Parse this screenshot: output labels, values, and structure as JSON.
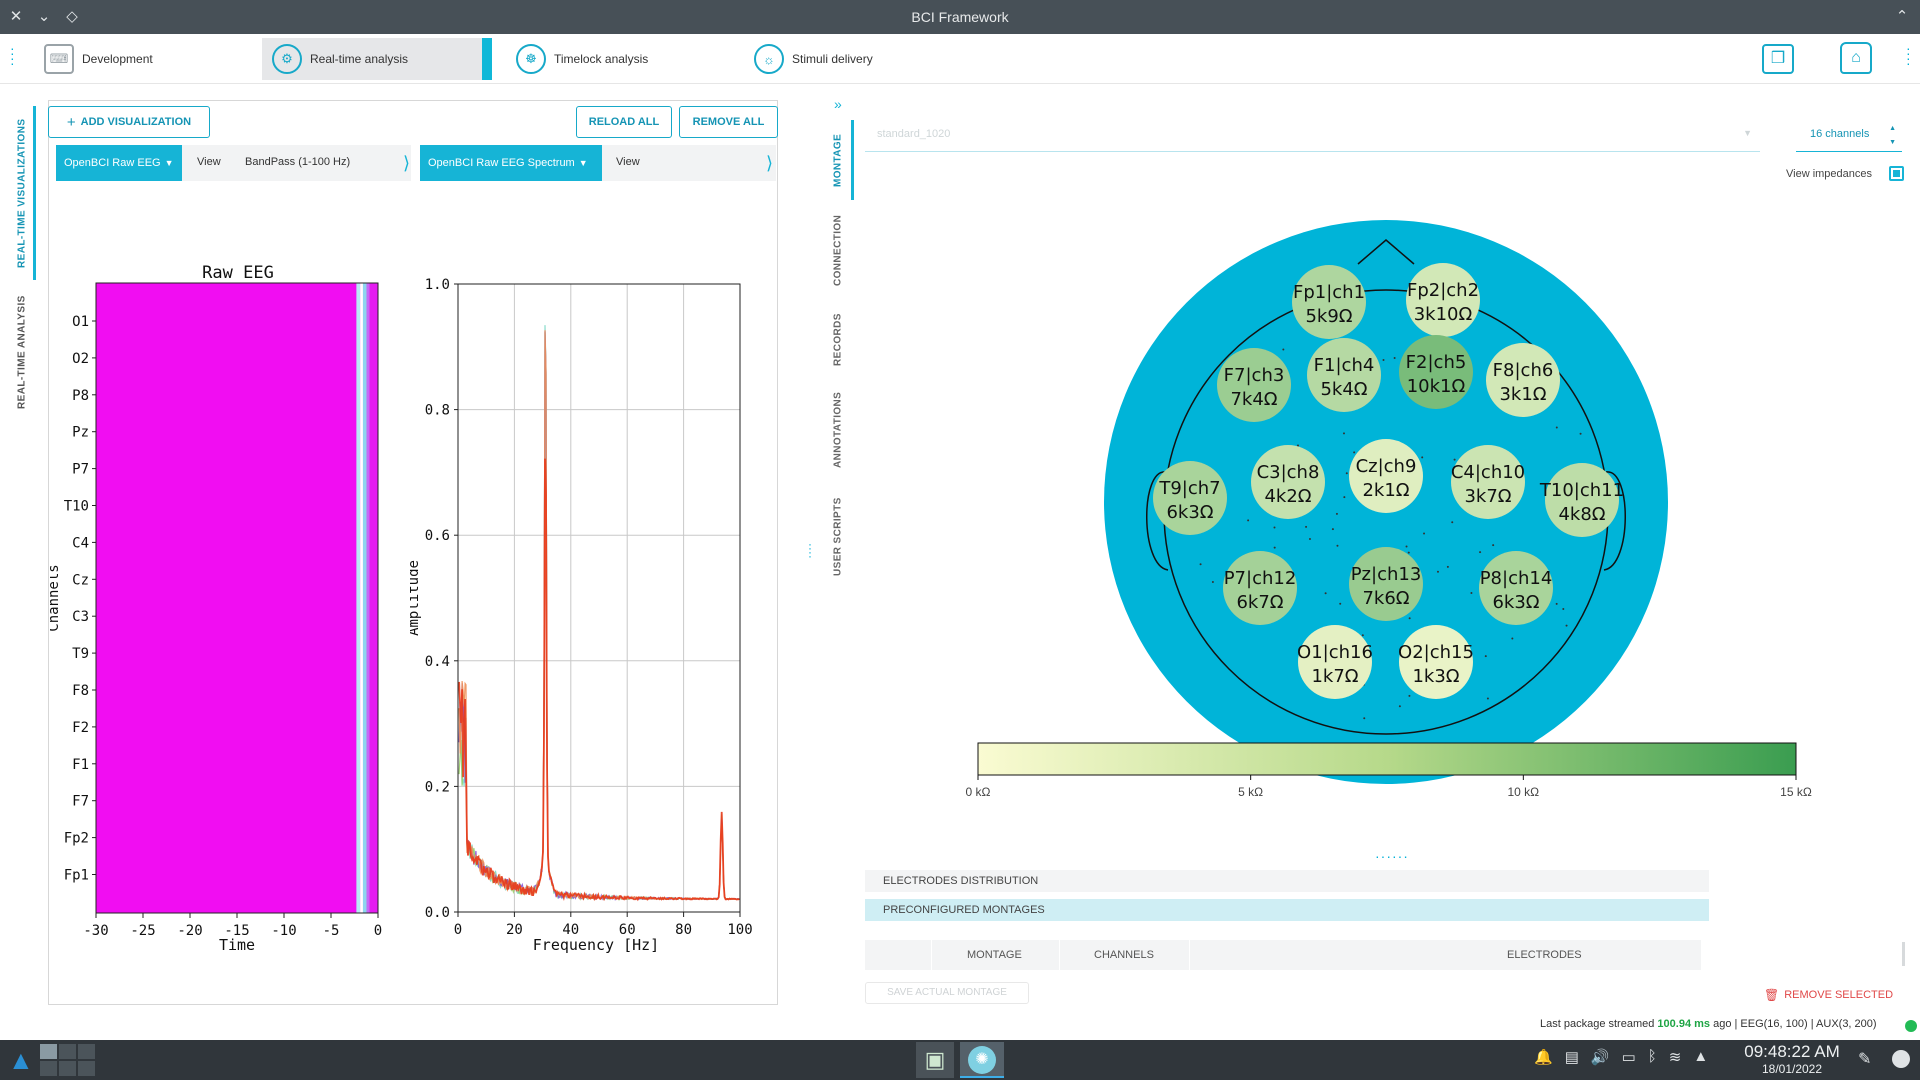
{
  "window": {
    "title": "BCI Framework"
  },
  "main_tabs": [
    {
      "label": "Development",
      "active": false
    },
    {
      "label": "Real-time analysis",
      "active": true
    },
    {
      "label": "Timelock analysis",
      "active": false
    },
    {
      "label": "Stimuli delivery",
      "active": false
    }
  ],
  "left_vertical_tabs": [
    {
      "label": "REAL-TIME VISUALIZATIONS",
      "active": true
    },
    {
      "label": "REAL-TIME ANALYSIS",
      "active": false
    }
  ],
  "toolbar": {
    "add_visualization": "ADD VISUALIZATION",
    "reload_all": "RELOAD ALL",
    "remove_all": "REMOVE ALL"
  },
  "visualizations": [
    {
      "name": "OpenBCI Raw EEG",
      "view_label": "View",
      "filter": "BandPass (1-100 Hz)"
    },
    {
      "name": "OpenBCI Raw EEG Spectrum",
      "view_label": "View"
    }
  ],
  "colors": {
    "accent": "#16b4d6",
    "head": "#00b4d8",
    "electrode_low": "#fafbd2",
    "electrode_high": "#3a9d50",
    "eeg_fill": "#f10df2",
    "status_ok": "#22bb55"
  },
  "chart_data": [
    {
      "type": "heatmap",
      "title": "Raw EEG",
      "xlabel": "Time",
      "ylabel": "Channels",
      "x_ticks": [
        -30,
        -25,
        -20,
        -15,
        -10,
        -5,
        0
      ],
      "xlim": [
        -30,
        0
      ],
      "channels": [
        "O1",
        "O2",
        "P8",
        "Pz",
        "P7",
        "T10",
        "C4",
        "Cz",
        "C3",
        "T9",
        "F8",
        "F2",
        "F1",
        "F7",
        "Fp2",
        "Fp1"
      ]
    },
    {
      "type": "line",
      "xlabel": "Frequency [Hz]",
      "ylabel": "Amplitude",
      "xlim": [
        0,
        100
      ],
      "ylim": [
        0,
        1.0
      ],
      "x_ticks": [
        0,
        20,
        40,
        60,
        80,
        100
      ],
      "y_ticks": [
        "0.0",
        "0.2",
        "0.4",
        "0.6",
        "0.8",
        "1.0"
      ],
      "grid": true,
      "peaks": [
        {
          "freq": 1,
          "amplitude": 0.42
        },
        {
          "freq": 31,
          "amplitude": 1.0
        },
        {
          "freq": 93.5,
          "amplitude": 0.14
        }
      ]
    },
    {
      "type": "heatmap",
      "subtype": "electrode-impedance-topomap",
      "electrodes": [
        {
          "label": "Fp1|ch1",
          "value": "5k9Ω",
          "kohm": 5.9
        },
        {
          "label": "Fp2|ch2",
          "value": "3k10Ω",
          "kohm": 3.1
        },
        {
          "label": "F7|ch3",
          "value": "7k4Ω",
          "kohm": 7.4
        },
        {
          "label": "F1|ch4",
          "value": "5k4Ω",
          "kohm": 5.4
        },
        {
          "label": "F2|ch5",
          "value": "10k1Ω",
          "kohm": 10.1
        },
        {
          "label": "F8|ch6",
          "value": "3k1Ω",
          "kohm": 3.1
        },
        {
          "label": "T9|ch7",
          "value": "6k3Ω",
          "kohm": 6.3
        },
        {
          "label": "C3|ch8",
          "value": "4k2Ω",
          "kohm": 4.2
        },
        {
          "label": "Cz|ch9",
          "value": "2k1Ω",
          "kohm": 2.1
        },
        {
          "label": "C4|ch10",
          "value": "3k7Ω",
          "kohm": 3.7
        },
        {
          "label": "T10|ch11",
          "value": "4k8Ω",
          "kohm": 4.8
        },
        {
          "label": "P7|ch12",
          "value": "6k7Ω",
          "kohm": 6.7
        },
        {
          "label": "Pz|ch13",
          "value": "7k6Ω",
          "kohm": 7.6
        },
        {
          "label": "P8|ch14",
          "value": "6k3Ω",
          "kohm": 6.3
        },
        {
          "label": "O1|ch16",
          "value": "1k7Ω",
          "kohm": 1.7
        },
        {
          "label": "O2|ch15",
          "value": "1k3Ω",
          "kohm": 1.3
        }
      ],
      "colorbar": {
        "min_kohm": 0,
        "max_kohm": 15,
        "ticks": [
          "0 kΩ",
          "5 kΩ",
          "10 kΩ",
          "15 kΩ"
        ]
      }
    }
  ],
  "right_side_tabs": [
    "MONTAGE",
    "CONNECTION",
    "RECORDS",
    "ANNOTATIONS",
    "USER SCRIPTS"
  ],
  "montage": {
    "selected": "standard_1020",
    "channels": "16 channels",
    "view_impedances": "View impedances",
    "view_impedances_checked": true,
    "sections": [
      "ELECTRODES DISTRIBUTION",
      "PRECONFIGURED MONTAGES"
    ],
    "table_headers": [
      "MONTAGE",
      "CHANNELS",
      "ELECTRODES"
    ],
    "save_button": "SAVE ACTUAL MONTAGE",
    "remove_selected": "REMOVE SELECTED"
  },
  "status": {
    "prefix": "Last package streamed",
    "latency": "100.94 ms",
    "suffix": "ago | EEG(16, 100) | AUX(3, 200)"
  },
  "taskbar": {
    "time": "09:48:22 AM",
    "date": "18/01/2022"
  }
}
